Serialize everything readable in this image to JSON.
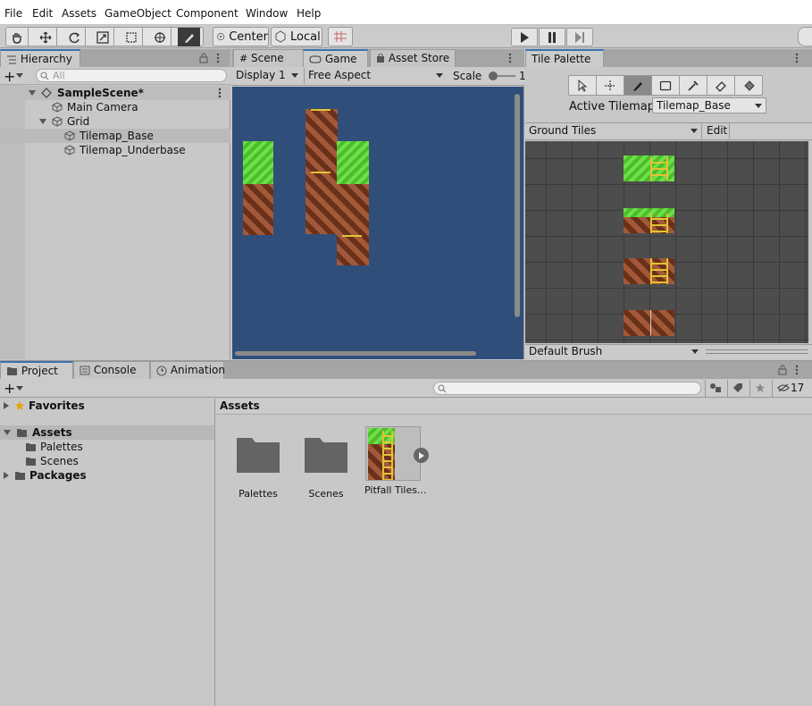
{
  "menu": {
    "items": [
      "File",
      "Edit",
      "Assets",
      "GameObject",
      "Component",
      "Window",
      "Help"
    ]
  },
  "toolbar": {
    "tools": [
      "hand-tool-icon",
      "move-tool-icon",
      "rotate-tool-icon",
      "scale-tool-icon",
      "rect-tool-icon",
      "transform-tool-icon",
      "custom-tool-icon"
    ],
    "pivot_label": "Center",
    "space_label": "Local"
  },
  "hierarchy": {
    "tab": "Hierarchy",
    "search_placeholder": "All",
    "scene": "SampleScene*",
    "items": [
      "Main Camera",
      "Grid",
      "Tilemap_Base",
      "Tilemap_Underbase"
    ],
    "selected": "Tilemap_Base"
  },
  "game_view": {
    "tabs": [
      "Scene",
      "Game",
      "Asset Store"
    ],
    "active_tab": "Game",
    "display": "Display 1",
    "aspect": "Free Aspect",
    "scale_label": "Scale",
    "scale_value": "1",
    "background": "#2f4f7a"
  },
  "tile_palette": {
    "tab": "Tile Palette",
    "active_tilemap_label": "Active Tilemap",
    "active_tilemap": "Tilemap_Base",
    "palette": "Ground Tiles",
    "edit_label": "Edit",
    "brush": "Default Brush"
  },
  "project": {
    "tabs": [
      "Project",
      "Console",
      "Animation"
    ],
    "active_tab": "Project",
    "favorites": "Favorites",
    "assets": "Assets",
    "folders": [
      "Palettes",
      "Scenes"
    ],
    "packages": "Packages",
    "breadcrumb": "Assets",
    "hidden_count": "17",
    "items": [
      "Palettes",
      "Scenes",
      "Pitfall Tiles..."
    ]
  }
}
